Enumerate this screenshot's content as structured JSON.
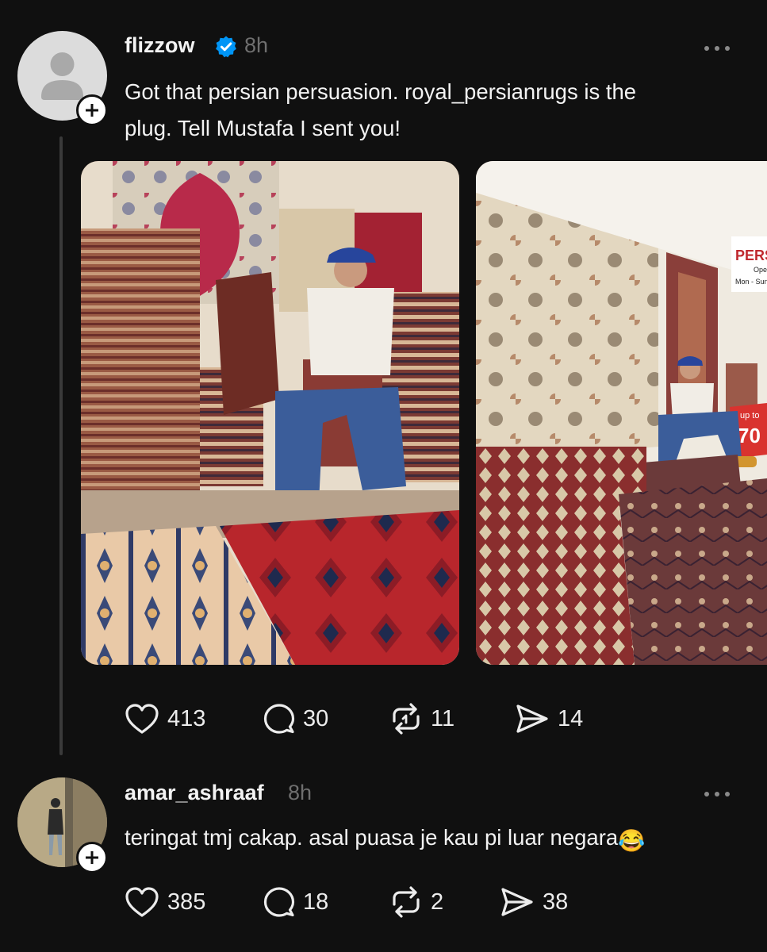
{
  "posts": [
    {
      "username": "flizzow",
      "verified": true,
      "time": "8h",
      "text_lines": [
        "Got that persian persuasion. royal_persianrugs is the",
        "plug. Tell Mustafa I sent you!"
      ],
      "images": [
        {
          "icon": "photo-man-seated-on-rug-stack"
        },
        {
          "icon": "photo-rug-shop-interior",
          "sign_text_lines": [
            "PERSI",
            "Ope",
            "Mon - Sun"
          ],
          "tag_text_lines": [
            "up to",
            "70"
          ]
        }
      ],
      "actions": {
        "likes": "413",
        "replies": "30",
        "reposts": "11",
        "shares": "14"
      }
    },
    {
      "username": "amar_ashraaf",
      "verified": false,
      "time": "8h",
      "text": "teringat tmj cakap. asal puasa je kau pi luar negara",
      "emoji": "😂",
      "actions": {
        "likes": "385",
        "replies": "18",
        "reposts": "2",
        "shares": "38"
      }
    }
  ],
  "colors": {
    "background": "#101010",
    "text": "#f3f3f3",
    "muted": "#6f6f6f",
    "verified_badge": "#0095f6",
    "thread_line": "#3a3a3a"
  }
}
